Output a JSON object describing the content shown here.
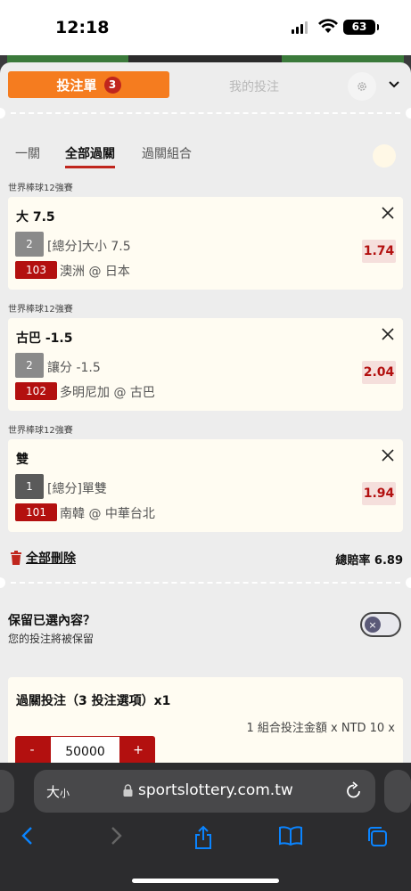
{
  "status": {
    "time": "12:18",
    "battery": "63"
  },
  "header": {
    "bet_slip_label": "投注單",
    "bet_count": "3",
    "my_bets_label": "我的投注"
  },
  "subtabs": [
    "一關",
    "全部過關",
    "過關組合"
  ],
  "bets": [
    {
      "league": "世界棒球12強賽",
      "title": "大 7.5",
      "seq": "2",
      "market": "[總分]大小 7.5",
      "match_no": "103",
      "match": "澳洲 @ 日本",
      "odds": "1.74"
    },
    {
      "league": "世界棒球12強賽",
      "title": "古巴 -1.5",
      "seq": "2",
      "market": "讓分 -1.5",
      "match_no": "102",
      "match": "多明尼加 @ 古巴",
      "odds": "2.04"
    },
    {
      "league": "世界棒球12強賽",
      "title": "雙",
      "seq": "1",
      "market": "[總分]單雙",
      "match_no": "101",
      "match": "南韓 @ 中華台北",
      "odds": "1.94"
    }
  ],
  "footer": {
    "delete_all": "全部刪除",
    "total_odds_label": "總賠率",
    "total_odds": "6.89"
  },
  "keep": {
    "title": "保留已選內容？",
    "subtitle": "您的投注將被保留"
  },
  "parlay": {
    "title": "過關投注（3 投注選項）x1",
    "info": "1 組合投注金額 x NTD 10 x",
    "minus": "-",
    "plus": "+",
    "amount": "50000"
  },
  "browser": {
    "text_size_big": "大",
    "text_size_small": "小",
    "url": "sportslottery.com.tw"
  }
}
